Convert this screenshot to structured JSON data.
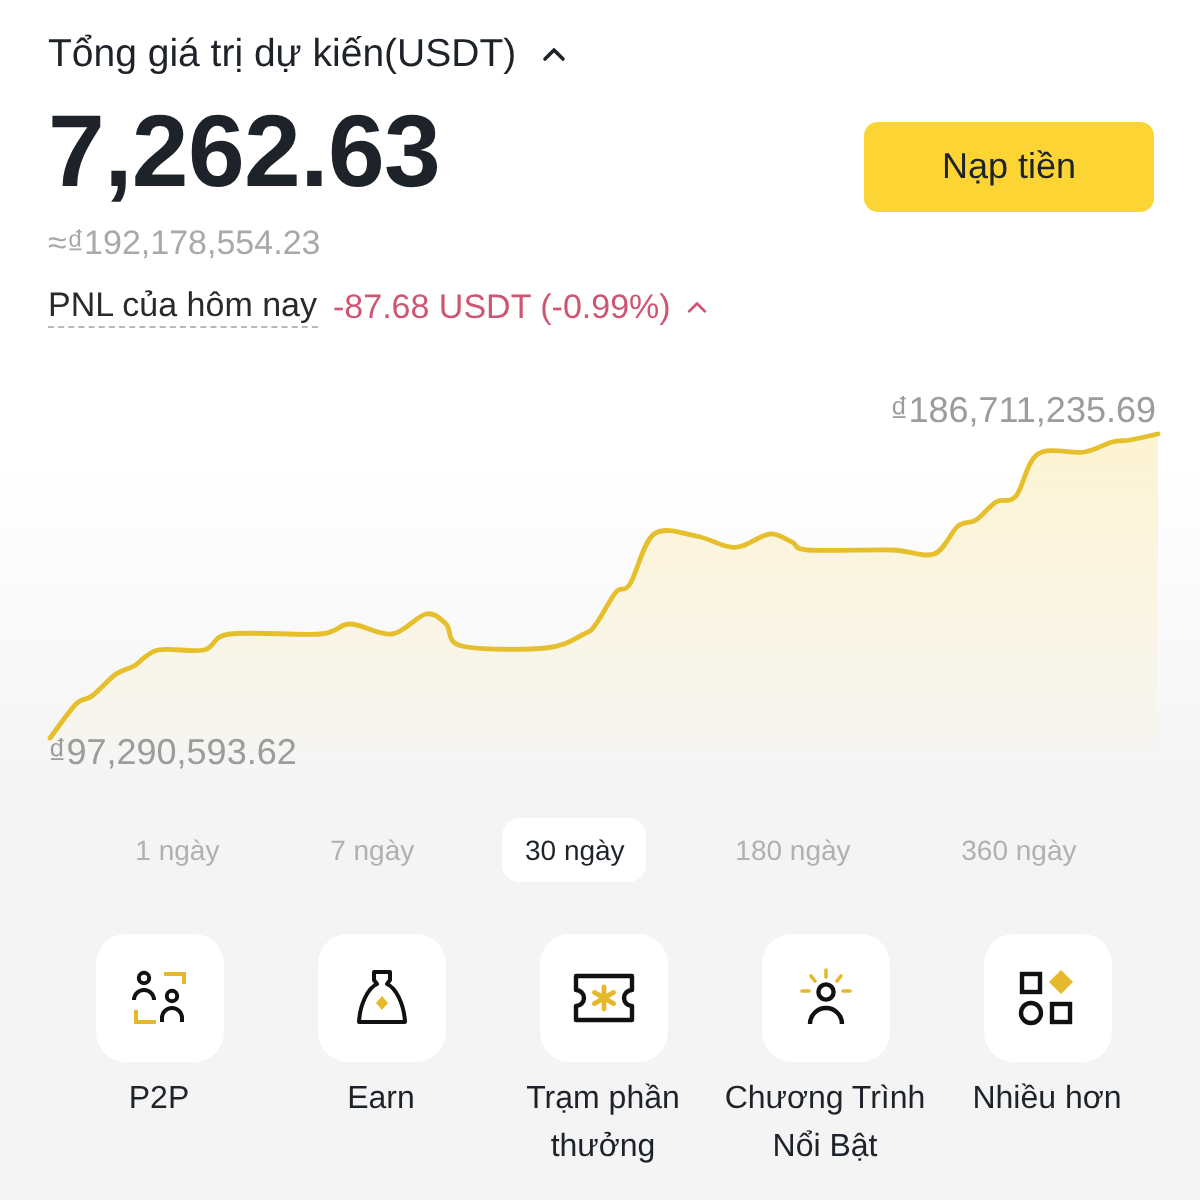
{
  "header": {
    "title": "Tổng giá trị dự kiến(USDT)",
    "total": "7,262.63",
    "deposit_button": "Nạp tiền",
    "approx_value": "≈₫192,178,554.23"
  },
  "pnl": {
    "label": "PNL của hôm nay",
    "value": "-87.68 USDT (-0.99%)"
  },
  "chart": {
    "max_label": "₫186,711,235.69",
    "min_label": "₫97,290,593.62"
  },
  "periods": [
    {
      "label": "1 ngày",
      "selected": false
    },
    {
      "label": "7 ngày",
      "selected": false
    },
    {
      "label": "30 ngày",
      "selected": true
    },
    {
      "label": "180 ngày",
      "selected": false
    },
    {
      "label": "360 ngày",
      "selected": false
    }
  ],
  "shortcuts": [
    {
      "kind": "p2p",
      "label": "P2P"
    },
    {
      "kind": "earn",
      "label": "Earn"
    },
    {
      "kind": "rewards",
      "label": "Trạm phần thưởng"
    },
    {
      "kind": "featured",
      "label": "Chương Trình Nổi Bật"
    },
    {
      "kind": "more",
      "label": "Nhiều hơn"
    }
  ]
}
